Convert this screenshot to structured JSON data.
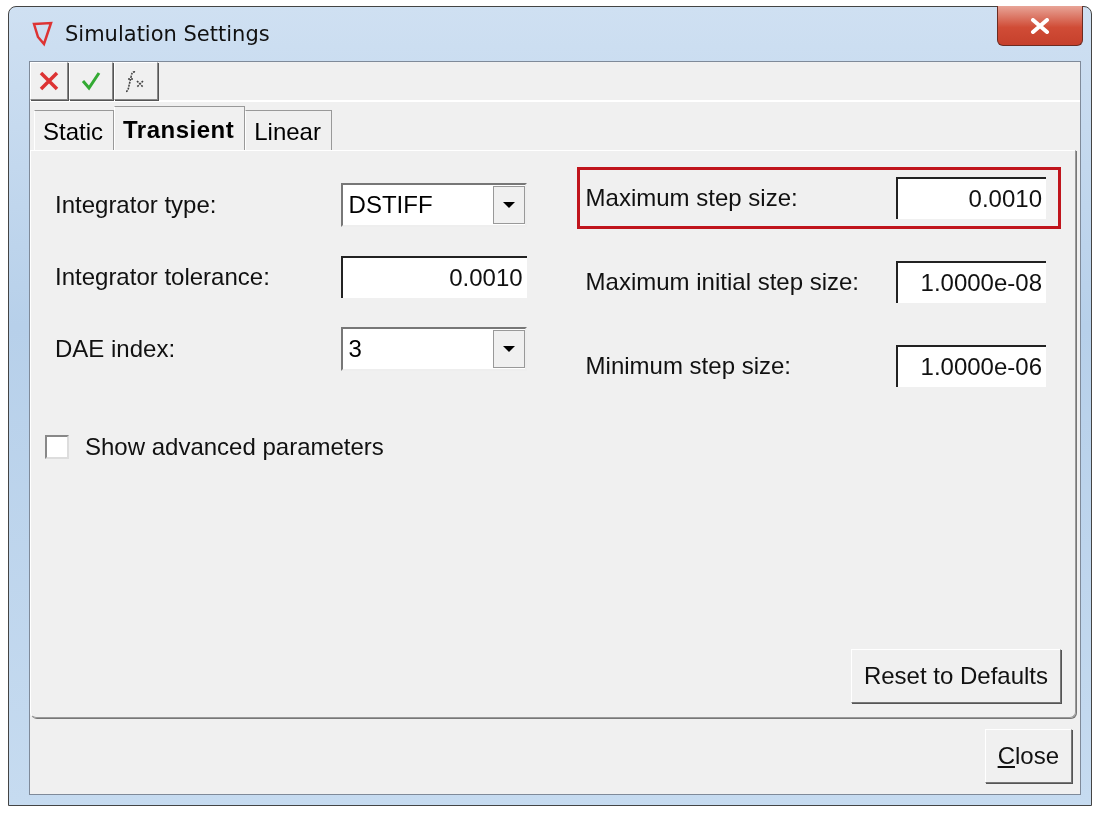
{
  "window": {
    "title": "Simulation Settings"
  },
  "toolbar": [
    {
      "kind": "cancel"
    },
    {
      "kind": "apply"
    },
    {
      "kind": "formula"
    }
  ],
  "tabs": [
    {
      "label": "Static",
      "selected": false
    },
    {
      "label": "Transient",
      "selected": true
    },
    {
      "label": "Linear",
      "selected": false
    }
  ],
  "left_fields": [
    {
      "kind": "dropdown",
      "label": "Integrator type:",
      "value": "DSTIFF"
    },
    {
      "kind": "number",
      "label": "Integrator tolerance:",
      "value": "0.0010"
    },
    {
      "kind": "dropdown",
      "label": "DAE index:",
      "value": "3"
    }
  ],
  "right_fields": [
    {
      "kind": "number",
      "label": "Maximum step size:",
      "value": "0.0010",
      "highlighted": true
    },
    {
      "kind": "number",
      "label": "Maximum initial step size:",
      "value": "1.0000e-08",
      "highlighted": false
    },
    {
      "kind": "number",
      "label": "Minimum step size:",
      "value": "1.0000e-06",
      "highlighted": false
    }
  ],
  "checkbox": {
    "label": "Show advanced parameters",
    "checked": false
  },
  "reset_button": "Reset to Defaults",
  "close_button": "Close"
}
